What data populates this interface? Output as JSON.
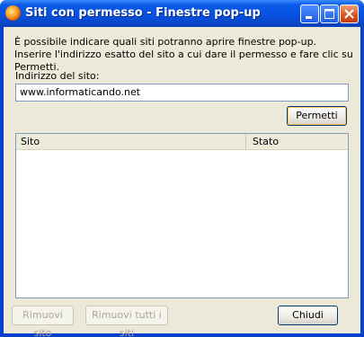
{
  "window": {
    "title": "Siti con permesso - Finestre pop-up",
    "controls": [
      "minimize",
      "maximize",
      "close"
    ]
  },
  "description": "È possibile indicare quali siti potranno aprire finestre pop-up. Inserire l'indirizzo esatto del sito a cui dare il permesso e fare clic su Permetti.",
  "url_field": {
    "label": "Indirizzo del sito:",
    "value": "www.informaticando.net"
  },
  "buttons": {
    "allow": "Permetti",
    "remove_site": "Rimuovi sito",
    "remove_all": "Rimuovi tutti i siti",
    "close": "Chiudi"
  },
  "site_list": {
    "columns": [
      "Sito",
      "Stato"
    ],
    "rows": []
  },
  "colors": {
    "titlebar": "#0752e0",
    "dialog_bg": "#ece9d8",
    "close_button": "#d6521e"
  }
}
